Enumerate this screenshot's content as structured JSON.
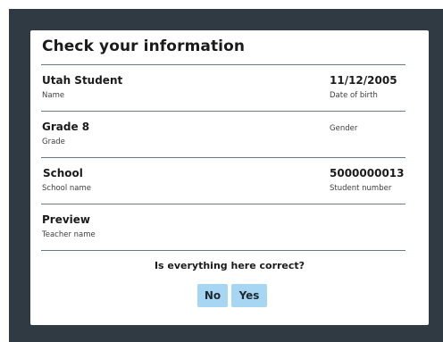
{
  "dialog": {
    "title": "Check your information",
    "prompt": "Is everything here correct?",
    "no_label": "No",
    "yes_label": "Yes"
  },
  "fields": {
    "name": {
      "value": "Utah Student",
      "label": "Name"
    },
    "dob": {
      "value": "11/12/2005",
      "label": "Date of birth"
    },
    "grade": {
      "value": "Grade 8",
      "label": "Grade"
    },
    "gender": {
      "value": "",
      "label": "Gender"
    },
    "school": {
      "value": "School",
      "label": "School name"
    },
    "student_number": {
      "value": "5000000013",
      "label": "Student number"
    },
    "teacher": {
      "value": "Preview",
      "label": "Teacher name"
    }
  },
  "colors": {
    "backdrop": "#2f3a43",
    "button": "#a7d6f3",
    "divider": "#6b7a88"
  }
}
